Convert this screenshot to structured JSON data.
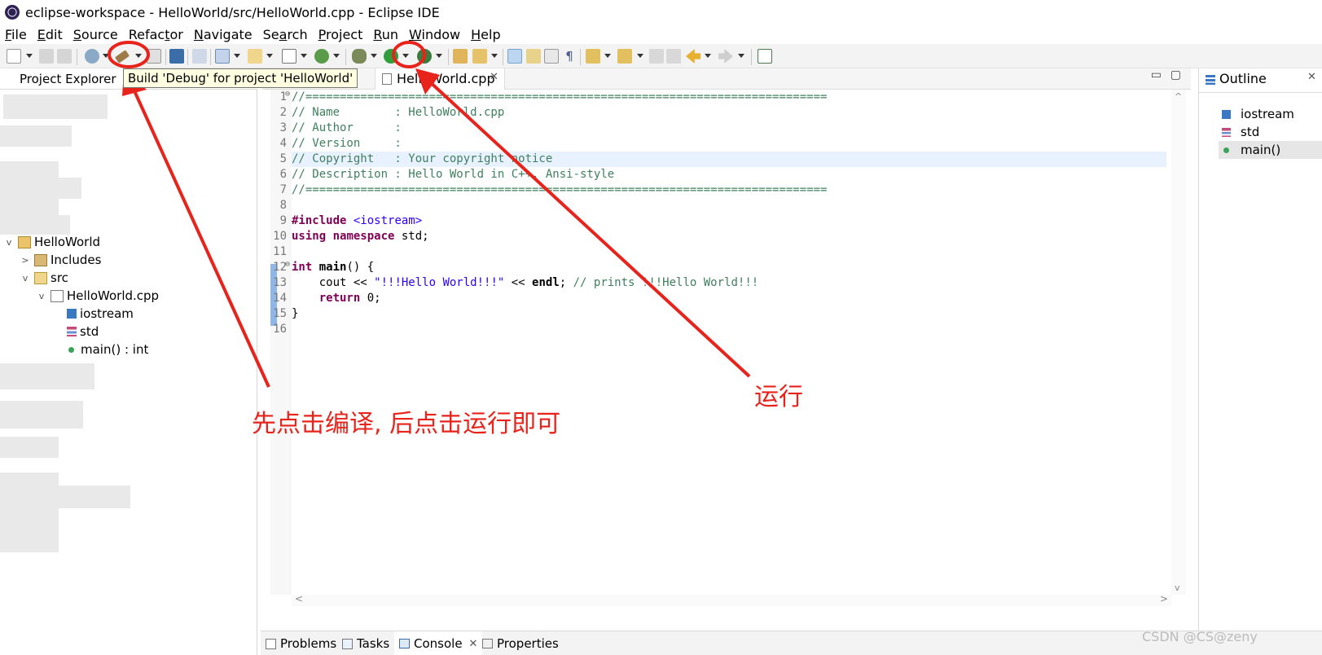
{
  "window": {
    "title": "eclipse-workspace - HelloWorld/src/HelloWorld.cpp - Eclipse IDE"
  },
  "menu": [
    {
      "u": "F",
      "rest": "ile"
    },
    {
      "u": "E",
      "rest": "dit"
    },
    {
      "u": "S",
      "rest": "ource"
    },
    {
      "pre": "Refac",
      "u": "t",
      "rest": "or"
    },
    {
      "u": "N",
      "rest": "avigate"
    },
    {
      "pre": "Se",
      "u": "a",
      "rest": "rch"
    },
    {
      "u": "P",
      "rest": "roject"
    },
    {
      "u": "R",
      "rest": "un"
    },
    {
      "u": "W",
      "rest": "indow"
    },
    {
      "u": "H",
      "rest": "elp"
    }
  ],
  "left_pane": {
    "tab_label": "Project Explorer",
    "tab_fragment": "a",
    "tooltip": "Build 'Debug' for project 'HelloWorld'",
    "tree": {
      "project": "HelloWorld",
      "includes": "Includes",
      "src": "src",
      "file": "HelloWorld.cpp",
      "iostream": "iostream",
      "std": "std",
      "main": "main() : int"
    }
  },
  "editor": {
    "tab_label": "HelloWorld.cpp",
    "line_numbers": [
      "1",
      "2",
      "3",
      "4",
      "5",
      "6",
      "7",
      "8",
      "9",
      "10",
      "11",
      "12",
      "13",
      "14",
      "15",
      "16"
    ],
    "code": {
      "l1": "//============================================================================",
      "l2": "// Name        : HelloWorld.cpp",
      "l3": "// Author      :",
      "l4": "// Version     :",
      "l5": "// Copyright   : Your copyright notice",
      "l6": "// Description : Hello World in C++, Ansi-style",
      "l7": "//============================================================================",
      "l9_kw": "#include",
      "l9_inc": " <iostream>",
      "l10_kw1": "using",
      "l10_kw2": "namespace",
      "l10_rest": " std;",
      "l12_kw": "int",
      "l12_fn": " main",
      "l12_rest": "() {",
      "l13_a": "    cout << ",
      "l13_str": "\"!!!Hello World!!!\"",
      "l13_b": " << ",
      "l13_endl": "endl",
      "l13_c": "; ",
      "l13_cm": "// prints !!!Hello World!!!",
      "l14_kw": "    return",
      "l14_rest": " 0;",
      "l15": "}"
    }
  },
  "outline": {
    "tab_label": "Outline",
    "items": [
      "iostream",
      "std",
      "main()"
    ]
  },
  "bottom_tabs": {
    "problems": "Problems",
    "tasks": "Tasks",
    "console": "Console",
    "properties": "Properties"
  },
  "annotations": {
    "build_then_run": "先点击编译, 后点击运行即可",
    "run": "运行",
    "color": "#e8231c"
  },
  "watermark": "CSDN @CS@zeny"
}
